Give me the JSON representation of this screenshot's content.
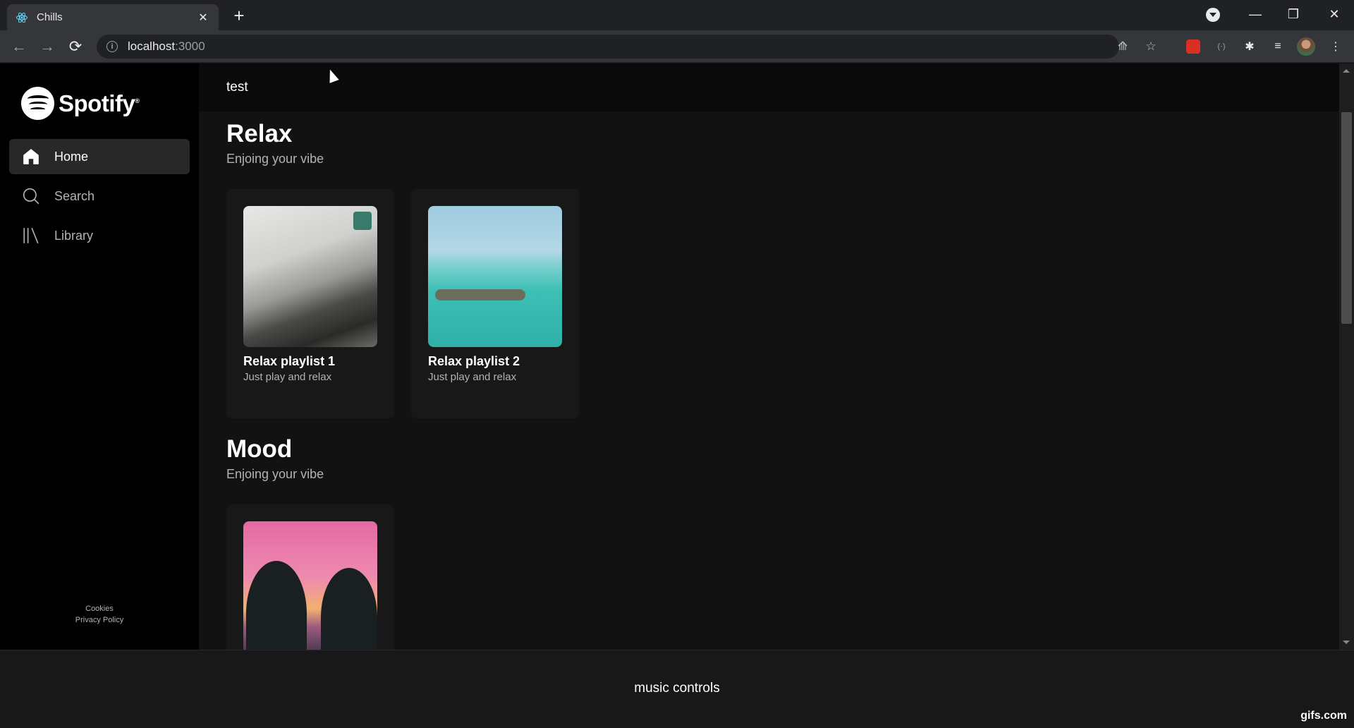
{
  "browser": {
    "tab_title": "Chills",
    "url_host": "localhost",
    "url_port": ":3000"
  },
  "sidebar": {
    "logo_text": "Spotify",
    "items": [
      {
        "label": "Home",
        "icon": "home-icon",
        "active": true
      },
      {
        "label": "Search",
        "icon": "search-icon",
        "active": false
      },
      {
        "label": "Library",
        "icon": "library-icon",
        "active": false
      }
    ],
    "footer": {
      "cookies": "Cookies",
      "privacy": "Privacy Policy"
    }
  },
  "topbar": {
    "text": "test"
  },
  "sections": [
    {
      "title": "Relax",
      "subtitle": "Enjoing your vibe",
      "cards": [
        {
          "title": "Relax playlist 1",
          "subtitle": "Just play and relax"
        },
        {
          "title": "Relax playlist 2",
          "subtitle": "Just play and relax"
        }
      ]
    },
    {
      "title": "Mood",
      "subtitle": "Enjoing your vibe",
      "cards": [
        {
          "title": "",
          "subtitle": ""
        }
      ]
    }
  ],
  "player": {
    "text": "music controls"
  },
  "watermark": "gifs.com",
  "colors": {
    "background": "#121212",
    "sidebar": "#000000",
    "card": "#181818",
    "active_nav": "#282828"
  }
}
